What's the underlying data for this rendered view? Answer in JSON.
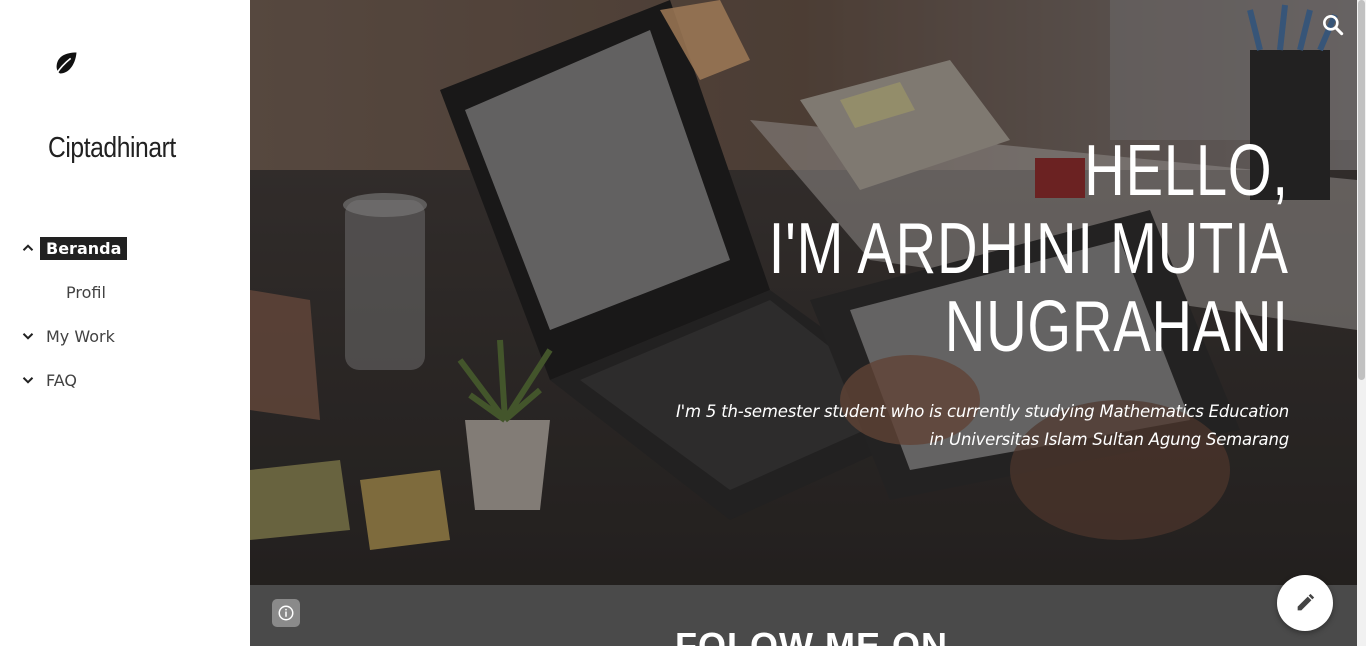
{
  "site": {
    "title": "Ciptadhinart",
    "logo_icon": "leaf-icon"
  },
  "nav": {
    "items": [
      {
        "label": "Beranda",
        "expanded": true,
        "active": true,
        "icon": "chevron-up-icon"
      },
      {
        "label": "Profil",
        "sub": true
      },
      {
        "label": "My Work",
        "expanded": false,
        "icon": "chevron-down-icon"
      },
      {
        "label": "FAQ",
        "expanded": false,
        "icon": "chevron-down-icon"
      }
    ]
  },
  "hero": {
    "line1": "HELLO,",
    "line2": "I'M ARDHINI MUTIA",
    "line3": "NUGRAHANI",
    "sub1": "I'm 5 th-semester student who is  currently studying  Mathematics Education",
    "sub2": "in Universitas Islam Sultan Agung Semarang"
  },
  "follow": {
    "title": "FOLOW ME ON"
  },
  "icons": {
    "search": "search-icon",
    "info": "info-icon",
    "edit": "pencil-icon"
  },
  "colors": {
    "active_nav_bg": "#212121",
    "hero_text": "#ffffff",
    "follow_bg": "#4a4a4a"
  }
}
